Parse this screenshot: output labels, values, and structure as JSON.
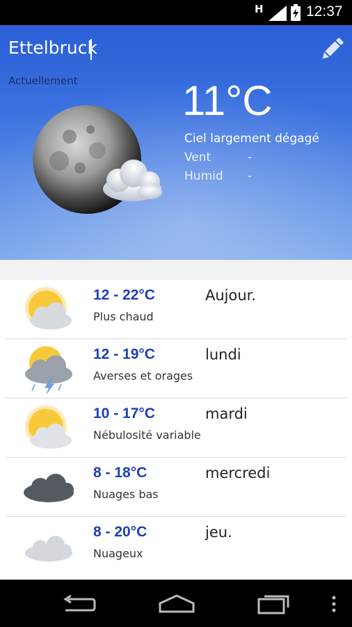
{
  "status_bar": {
    "network": "H",
    "time": "12:37"
  },
  "header": {
    "city": "Ettelbruck",
    "now_label": "Actuellement",
    "temperature": "11°C",
    "condition": "Ciel largement dégagé",
    "wind_label": "Vent",
    "wind_value": "-",
    "humidity_label": "Humid",
    "humidity_value": "-"
  },
  "forecast": [
    {
      "range": "12 - 22°C",
      "desc": "Plus chaud",
      "day": "Aujour.",
      "icon": "sun-cloud-icon"
    },
    {
      "range": "12 - 19°C",
      "desc": "Averses et orages",
      "day": "lundi",
      "icon": "thunderstorm-icon"
    },
    {
      "range": "10 - 17°C",
      "desc": "Nébulosité variable",
      "day": "mardi",
      "icon": "sun-cloud-icon"
    },
    {
      "range": "8 - 18°C",
      "desc": "Nuages bas",
      "day": "mercredi",
      "icon": "dark-cloud-icon"
    },
    {
      "range": "8 - 20°C",
      "desc": "Nuageux",
      "day": "jeu.",
      "icon": "cloud-icon"
    }
  ],
  "colors": {
    "sky_top": "#2a5fd6",
    "temp_range": "#1f3fb2"
  }
}
